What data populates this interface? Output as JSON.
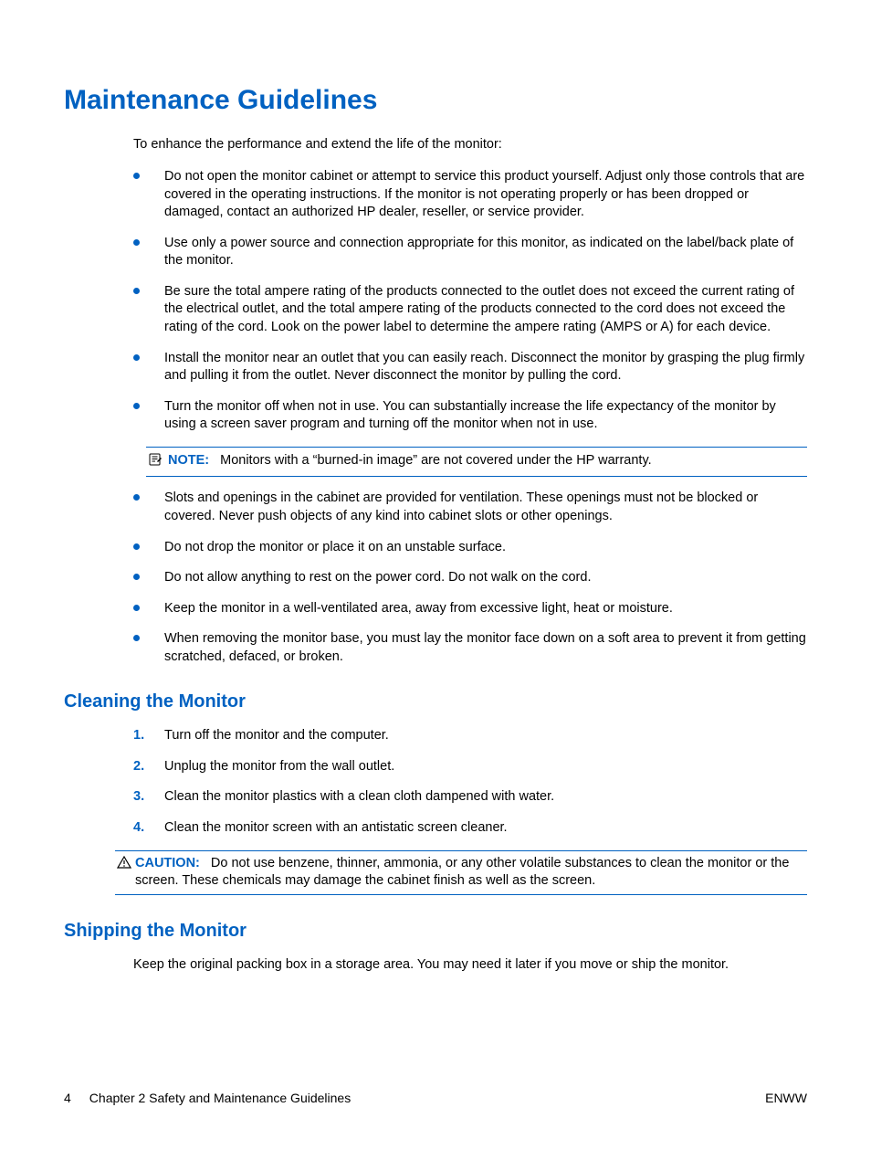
{
  "title": "Maintenance Guidelines",
  "intro": "To enhance the performance and extend the life of the monitor:",
  "bullets_a": [
    "Do not open the monitor cabinet or attempt to service this product yourself. Adjust only those controls that are covered in the operating instructions. If the monitor is not operating properly or has been dropped or damaged, contact an authorized HP dealer, reseller, or service provider.",
    "Use only a power source and connection appropriate for this monitor, as indicated on the label/back plate of the monitor.",
    "Be sure the total ampere rating of the products connected to the outlet does not exceed the current rating of the electrical outlet, and the total ampere rating of the products connected to the cord does not exceed the rating of the cord. Look on the power label to determine the ampere rating (AMPS or A) for each device.",
    "Install the monitor near an outlet that you can easily reach. Disconnect the monitor by grasping the plug firmly and pulling it from the outlet. Never disconnect the monitor by pulling the cord.",
    "Turn the monitor off when not in use. You can substantially increase the life expectancy of the monitor by using a screen saver program and turning off the monitor when not in use."
  ],
  "note": {
    "label": "NOTE:",
    "text": "Monitors with a “burned-in image” are not covered under the HP warranty."
  },
  "bullets_b": [
    "Slots and openings in the cabinet are provided for ventilation. These openings must not be blocked or covered. Never push objects of any kind into cabinet slots or other openings.",
    "Do not drop the monitor or place it on an unstable surface.",
    "Do not allow anything to rest on the power cord. Do not walk on the cord.",
    "Keep the monitor in a well-ventilated area, away from excessive light, heat or moisture.",
    "When removing the monitor base, you must lay the monitor face down on a soft area to prevent it from getting scratched, defaced, or broken."
  ],
  "cleaning": {
    "heading": "Cleaning the Monitor",
    "steps": [
      "Turn off the monitor and the computer.",
      "Unplug the monitor from the wall outlet.",
      "Clean the monitor plastics with a clean cloth dampened with water.",
      "Clean the monitor screen with an antistatic screen cleaner."
    ],
    "caution": {
      "label": "CAUTION:",
      "text": "Do not use benzene, thinner, ammonia, or any other volatile substances to clean the monitor or the screen. These chemicals may damage the cabinet finish as well as the screen."
    }
  },
  "shipping": {
    "heading": "Shipping the Monitor",
    "text": "Keep the original packing box in a storage area. You may need it later if you move or ship the monitor."
  },
  "footer": {
    "page": "4",
    "chapter": "Chapter 2   Safety and Maintenance Guidelines",
    "locale": "ENWW"
  }
}
